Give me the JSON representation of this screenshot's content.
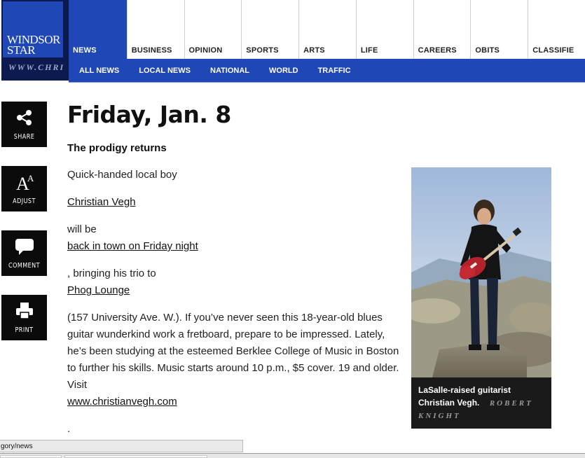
{
  "site": {
    "logo_line1": "WINDSOR",
    "logo_line2": "STAR",
    "url_strip": "WWW.CHRI"
  },
  "nav": {
    "tabs": [
      {
        "label": "NEWS",
        "active": true
      },
      {
        "label": "BUSINESS",
        "active": false
      },
      {
        "label": "OPINION",
        "active": false
      },
      {
        "label": "SPORTS",
        "active": false
      },
      {
        "label": "ARTS",
        "active": false
      },
      {
        "label": "LIFE",
        "active": false
      },
      {
        "label": "CAREERS",
        "active": false
      },
      {
        "label": "OBITS",
        "active": false
      },
      {
        "label": "CLASSIFIE",
        "active": false
      }
    ],
    "sub": [
      "ALL NEWS",
      "LOCAL NEWS",
      "NATIONAL",
      "WORLD",
      "TRAFFIC"
    ]
  },
  "tools": {
    "share": "SHARE",
    "adjust": "ADJUST",
    "comment": "COMMENT",
    "print": "PRINT"
  },
  "article": {
    "headline": "Friday, Jan. 8",
    "subhead": "The prodigy returns",
    "p1": "Quick-handed local boy",
    "link1": "Christian Vegh",
    "p2": "will be",
    "link2": "back in town on Friday night",
    "p3": ", bringing his trio to",
    "link3": "Phog Lounge",
    "p4": "(157 University Ave. W.). If you’ve never seen this 18-year-old blues guitar wunderkind work a fretboard, prepare to be impressed. Lately, he’s been studying at the esteemed Berklee College of Music in Boston to further his skills. Music starts around 10 p.m., $5 cover. 19 and older. Visit",
    "link4": "www.christianvegh.com",
    "p5": "."
  },
  "photo": {
    "caption": "LaSalle-raised guitarist Christian Vegh.",
    "credit": "ROBERT KNIGHT"
  },
  "status_bar": {
    "url": "gory/news"
  },
  "colors": {
    "brand_blue": "#1f47b5",
    "logo_navy": "#0d1a4f",
    "tool_black": "#0b0b0b"
  }
}
